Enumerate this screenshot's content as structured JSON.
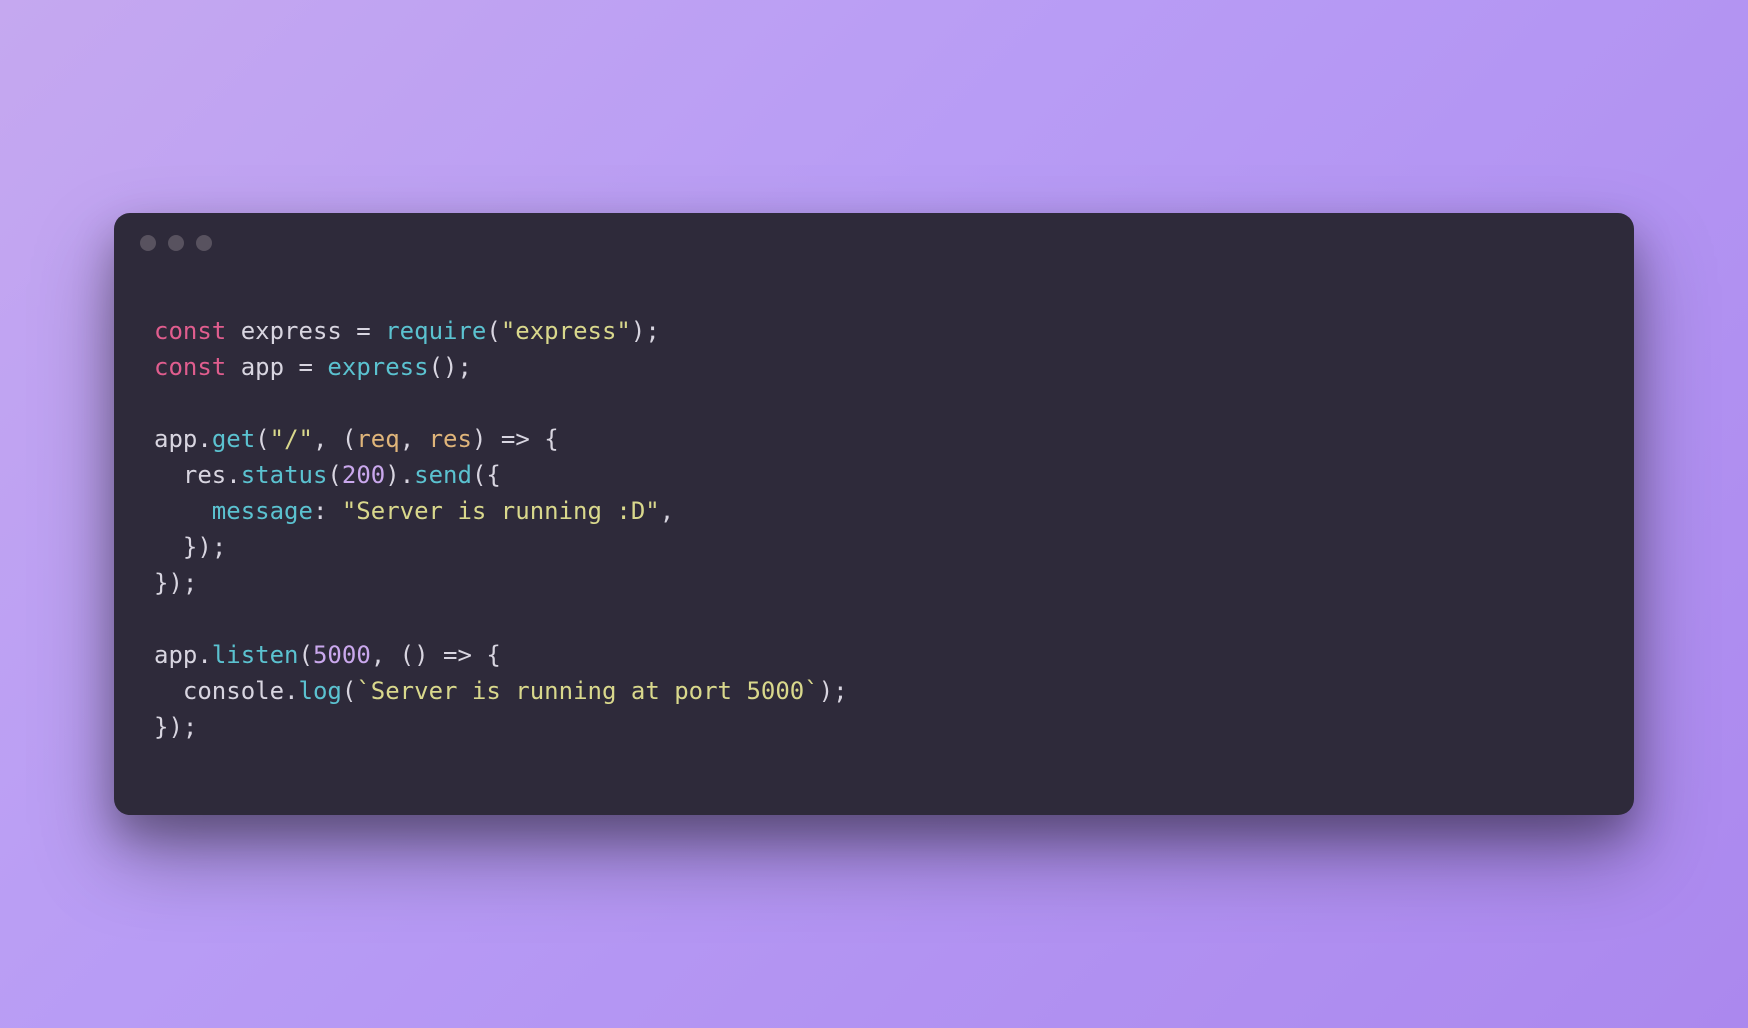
{
  "code": {
    "line1": {
      "const": "const",
      "express": "express",
      "equals": " = ",
      "require": "require",
      "openParen": "(",
      "expressStr": "\"express\"",
      "closeParen": ")",
      "semi": ";"
    },
    "line2": {
      "const": "const",
      "app": "app",
      "equals": " = ",
      "express": "express",
      "parens": "()",
      "semi": ";"
    },
    "line4": {
      "app": "app",
      "dot": ".",
      "get": "get",
      "openParen": "(",
      "path": "\"/\"",
      "comma": ", ",
      "arrowOpen": "(",
      "req": "req",
      "commaParam": ", ",
      "res": "res",
      "arrowClose": ")",
      "arrow": " => ",
      "brace": "{"
    },
    "line5": {
      "indent": "  ",
      "res": "res",
      "dot1": ".",
      "status": "status",
      "openParen1": "(",
      "code": "200",
      "closeParen1": ")",
      "dot2": ".",
      "send": "send",
      "openParen2": "(",
      "brace": "{"
    },
    "line6": {
      "indent": "    ",
      "message": "message",
      "colon": ": ",
      "value": "\"Server is running :D\"",
      "comma": ","
    },
    "line7": {
      "indent": "  ",
      "closeBrace": "}",
      "closeParen": ")",
      "semi": ";"
    },
    "line8": {
      "closeBrace": "}",
      "closeParen": ")",
      "semi": ";"
    },
    "line10": {
      "app": "app",
      "dot": ".",
      "listen": "listen",
      "openParen": "(",
      "port": "5000",
      "comma": ", ",
      "arrowOpen": "(",
      "arrowClose": ")",
      "arrow": " => ",
      "brace": "{"
    },
    "line11": {
      "indent": "  ",
      "console": "console",
      "dot": ".",
      "log": "log",
      "openParen": "(",
      "msg": "`Server is running at port 5000`",
      "closeParen": ")",
      "semi": ";"
    },
    "line12": {
      "closeBrace": "}",
      "closeParen": ")",
      "semi": ";"
    }
  }
}
